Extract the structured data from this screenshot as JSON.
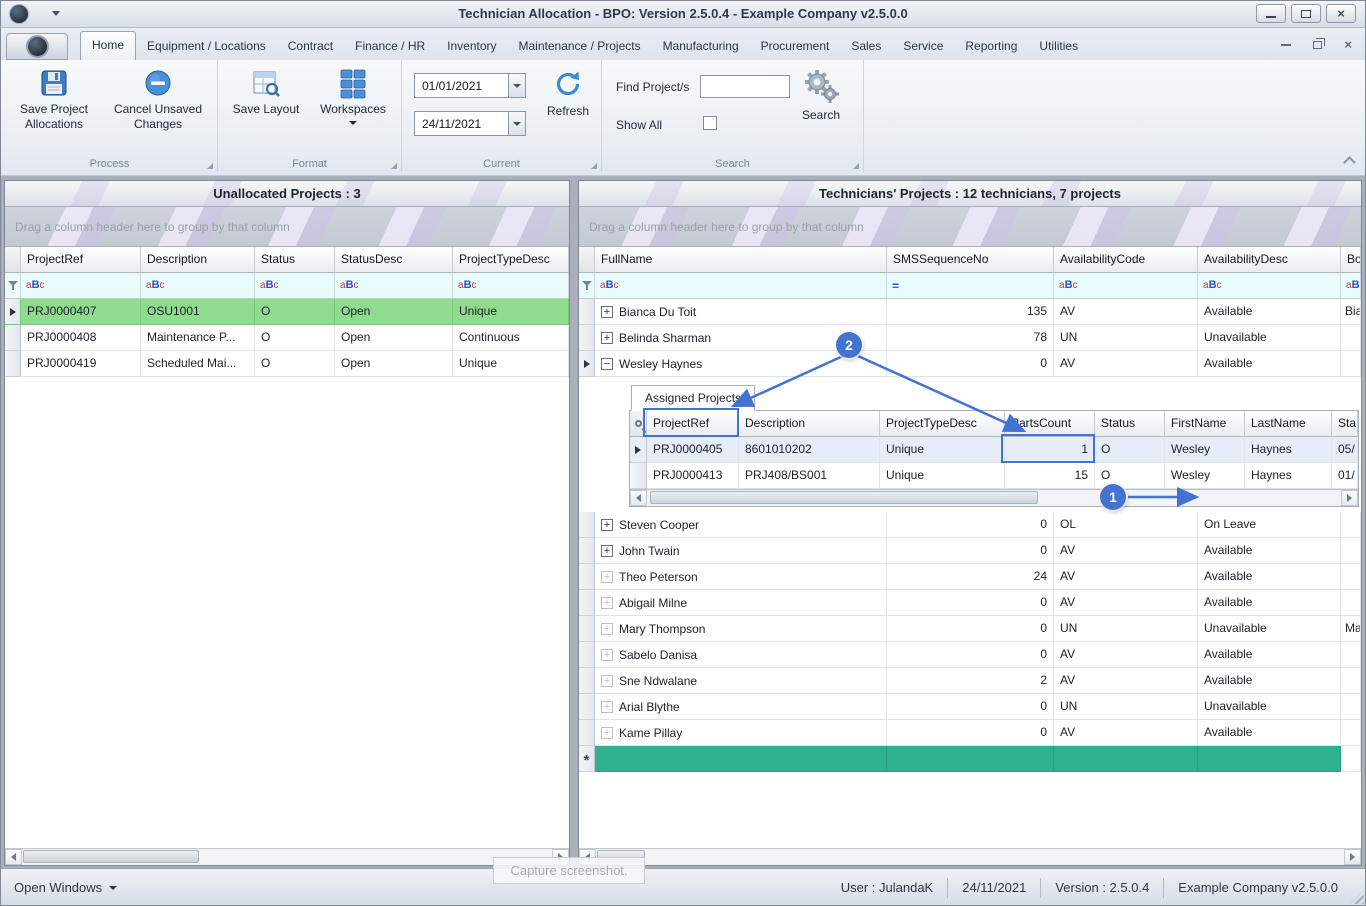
{
  "titlebar": {
    "title": "Technician Allocation - BPO: Version 2.5.0.4 - Example Company v2.5.0.0"
  },
  "ribbon": {
    "tabs": [
      "Home",
      "Equipment / Locations",
      "Contract",
      "Finance / HR",
      "Inventory",
      "Maintenance / Projects",
      "Manufacturing",
      "Procurement",
      "Sales",
      "Service",
      "Reporting",
      "Utilities"
    ],
    "active_tab": "Home",
    "process": {
      "caption": "Process",
      "save_button": "Save Project Allocations",
      "cancel_button": "Cancel Unsaved Changes"
    },
    "format": {
      "caption": "Format",
      "save_layout_button": "Save Layout",
      "workspaces_button": "Workspaces"
    },
    "current": {
      "caption": "Current",
      "start_date": "01/01/2021",
      "end_date": "24/11/2021",
      "refresh_button": "Refresh"
    },
    "search": {
      "caption": "Search",
      "find_label": "Find Project/s",
      "find_value": "",
      "show_all_label": "Show All",
      "show_all_checked": false,
      "search_button": "Search"
    }
  },
  "left_panel": {
    "title": "Unallocated Projects : 3",
    "group_hint": "Drag a column header here to group by that column",
    "columns": [
      "ProjectRef",
      "Description",
      "Status",
      "StatusDesc",
      "ProjectTypeDesc"
    ],
    "filters": [
      "abc",
      "abc",
      "abc",
      "abc",
      "abc"
    ],
    "rows": [
      {
        "cells": [
          "PRJ0000407",
          "OSU1001",
          "O",
          "Open",
          "Unique"
        ],
        "selected": true
      },
      {
        "cells": [
          "PRJ0000408",
          "Maintenance P...",
          "O",
          "Open",
          "Continuous"
        ],
        "selected": false
      },
      {
        "cells": [
          "PRJ0000419",
          "Scheduled Mai...",
          "O",
          "Open",
          "Unique"
        ],
        "selected": false
      }
    ]
  },
  "right_panel": {
    "title": "Technicians' Projects : 12 technicians, 7 projects",
    "group_hint": "Drag a column header here to group by that column",
    "columns": [
      "FullName",
      "SMSSequenceNo",
      "AvailabilityCode",
      "AvailabilityDesc",
      "Boo"
    ],
    "filters": [
      "abc",
      "eq",
      "abc",
      "abc",
      "abc"
    ],
    "rows": [
      {
        "cells": [
          "Bianca Du Toit",
          "135",
          "AV",
          "Available",
          "Bia"
        ],
        "expand": "plus",
        "dim": false
      },
      {
        "cells": [
          "Belinda Sharman",
          "78",
          "UN",
          "Unavailable",
          ""
        ],
        "expand": "plus",
        "dim": false
      },
      {
        "cells": [
          "Wesley Haynes",
          "0",
          "AV",
          "Available",
          ""
        ],
        "expand": "minus",
        "expanded": true,
        "indicator": true,
        "dim": false
      },
      {
        "cells": [
          "Steven Cooper",
          "0",
          "OL",
          "On Leave",
          ""
        ],
        "expand": "plus",
        "dim": false
      },
      {
        "cells": [
          "John Twain",
          "0",
          "AV",
          "Available",
          ""
        ],
        "expand": "plus",
        "dim": false
      },
      {
        "cells": [
          "Theo Peterson",
          "24",
          "AV",
          "Available",
          ""
        ],
        "expand": "plus",
        "dim": true
      },
      {
        "cells": [
          "Abigail Milne",
          "0",
          "AV",
          "Available",
          ""
        ],
        "expand": "plus",
        "dim": true
      },
      {
        "cells": [
          "Mary Thompson",
          "0",
          "UN",
          "Unavailable",
          "Ma"
        ],
        "expand": "plus",
        "dim": true
      },
      {
        "cells": [
          "Sabelo Danisa",
          "0",
          "AV",
          "Available",
          ""
        ],
        "expand": "plus",
        "dim": true
      },
      {
        "cells": [
          "Sne Ndwalane",
          "2",
          "AV",
          "Available",
          ""
        ],
        "expand": "plus",
        "dim": true
      },
      {
        "cells": [
          "Arial Blythe",
          "0",
          "UN",
          "Unavailable",
          ""
        ],
        "expand": "plus",
        "dim": true
      },
      {
        "cells": [
          "Kame Pillay",
          "0",
          "AV",
          "Available",
          ""
        ],
        "expand": "plus",
        "dim": true
      }
    ],
    "new_row_symbol": "*",
    "detail": {
      "tab": "Assigned Projects",
      "columns": [
        "ProjectRef",
        "Description",
        "ProjectTypeDesc",
        "PartsCount",
        "Status",
        "FirstName",
        "LastName",
        "Sta"
      ],
      "rows": [
        {
          "cells": [
            "PRJ0000405",
            "8601010202",
            "Unique",
            "1",
            "O",
            "Wesley",
            "Haynes",
            "05/"
          ],
          "selected": true,
          "indicator": true
        },
        {
          "cells": [
            "PRJ0000413",
            "PRJ408/BS001",
            "Unique",
            "15",
            "O",
            "Wesley",
            "Haynes",
            "01/"
          ],
          "selected": false,
          "indicator": false
        }
      ]
    }
  },
  "statusbar": {
    "open_windows": "Open Windows",
    "user": "User : JulandaK",
    "date": "24/11/2021",
    "version": "Version : 2.5.0.4",
    "company": "Example Company v2.5.0.0"
  },
  "overlay": {
    "capture_hint": "Capture screenshot.",
    "badge_one": "1",
    "badge_two": "2"
  },
  "colors": {
    "selected_row_green": "#8fdc8f",
    "new_row_teal": "#2fb08e",
    "annotation_blue": "#4273d3",
    "detail_selected_blue": "#e6edf7"
  }
}
